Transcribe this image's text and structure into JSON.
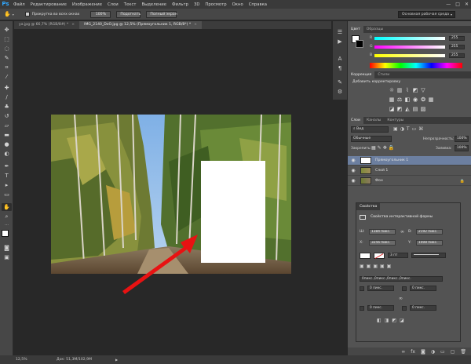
{
  "app": {
    "logo": "Ps"
  },
  "menu": [
    "Файл",
    "Редактирование",
    "Изображение",
    "Слои",
    "Текст",
    "Выделение",
    "Фильтр",
    "3D",
    "Просмотр",
    "Окно",
    "Справка"
  ],
  "window_controls": {
    "minimize": "—",
    "maximize": "□",
    "close": "✕"
  },
  "options_bar": {
    "scroll_all_label": "Прокрутка во всех окнах",
    "zoom_100": "100%",
    "fit_screen": "Подогнать",
    "full_screen": "Полный экран",
    "workspace": "Основная рабочая среда"
  },
  "doc_tabs": [
    {
      "label": "ya.jpg @ 66,7% (RGB/8#) *",
      "active": false
    },
    {
      "label": "IMG_2140_DxO.jpg @ 12,5% (Прямоугольник 1, RGB/8*) *",
      "active": true
    }
  ],
  "tab_close": "×",
  "status": {
    "zoom": "12,5%",
    "doc": "Док: 51,3M/102,9M",
    "arrow": "▶"
  },
  "color_panel": {
    "tabs": [
      "Цвет",
      "Образцы"
    ],
    "channels": [
      {
        "label": "R",
        "value": "255"
      },
      {
        "label": "G",
        "value": "255"
      },
      {
        "label": "B",
        "value": "255"
      }
    ]
  },
  "adjustments_panel": {
    "tabs": [
      "Коррекция",
      "Стили"
    ],
    "title": "Добавить корректировку",
    "icons": [
      "brightness-icon",
      "levels-icon",
      "curves-icon",
      "exposure-icon",
      "vibrance-icon",
      "hue-icon",
      "balance-icon",
      "bw-icon",
      "photo-filter-icon",
      "mixer-icon",
      "lookup-icon",
      "invert-icon",
      "posterize-icon",
      "threshold-icon",
      "gradient-map-icon",
      "selective-color-icon"
    ]
  },
  "layers_panel": {
    "tabs": [
      "Слои",
      "Каналы",
      "Контуры"
    ],
    "kind": "Вид",
    "blend_mode": "Обычные",
    "opacity_label": "Непрозрачность:",
    "opacity": "100%",
    "lock_label": "Закрепить:",
    "fill_label": "Заливка:",
    "fill": "100%",
    "layers": [
      {
        "name": "Прямоугольник 1",
        "selected": true
      },
      {
        "name": "Слой 1",
        "selected": false
      },
      {
        "name": "Фон",
        "selected": false
      }
    ]
  },
  "properties_panel": {
    "tab": "Свойства",
    "title": "Свойства интерактивной формы",
    "w_label": "Ш:",
    "w": "1384 пикс.",
    "h_label": "В:",
    "h": "2192 пикс.",
    "x_label": "X:",
    "x": "3256 пикс.",
    "y_label": "Y:",
    "y": "1008 пикс.",
    "stroke_size": "3 пт",
    "corners": "0пикс.,0пикс.,0пикс.,0пикс.",
    "corner_values": [
      "0 пикс.",
      "0 пикс.",
      "0 пикс.",
      "0 пикс."
    ]
  }
}
